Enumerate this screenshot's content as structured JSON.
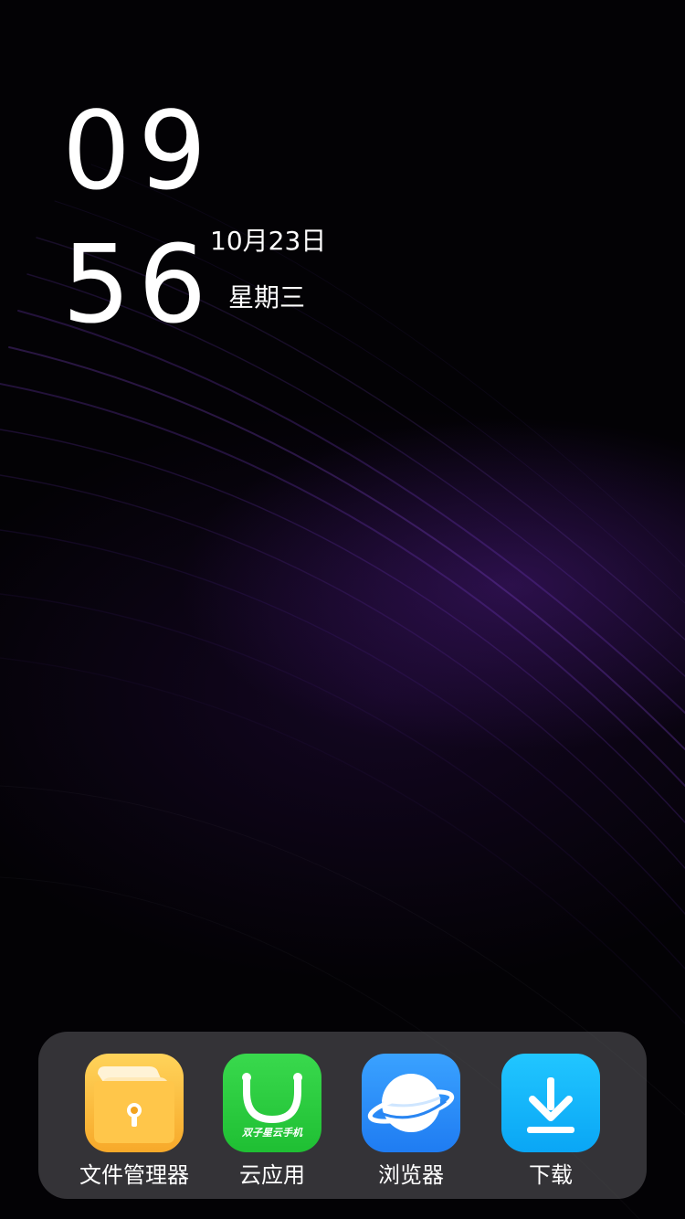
{
  "lockscreen": {
    "time_hour": "09",
    "time_minute": "56",
    "date": "10月23日",
    "weekday": "星期三"
  },
  "dock": {
    "apps": [
      {
        "label": "文件管理器",
        "icon": "folder-icon",
        "color": "#F9B93A"
      },
      {
        "label": "云应用",
        "icon": "shopping-bag-icon",
        "color": "#2CCB3F",
        "badge_text": "双子星云手机"
      },
      {
        "label": "浏览器",
        "icon": "planet-icon",
        "color": "#2B8EF8"
      },
      {
        "label": "下载",
        "icon": "download-icon",
        "color": "#14B5FA"
      }
    ]
  },
  "colors": {
    "wallpaper_accent": "#46197A"
  }
}
